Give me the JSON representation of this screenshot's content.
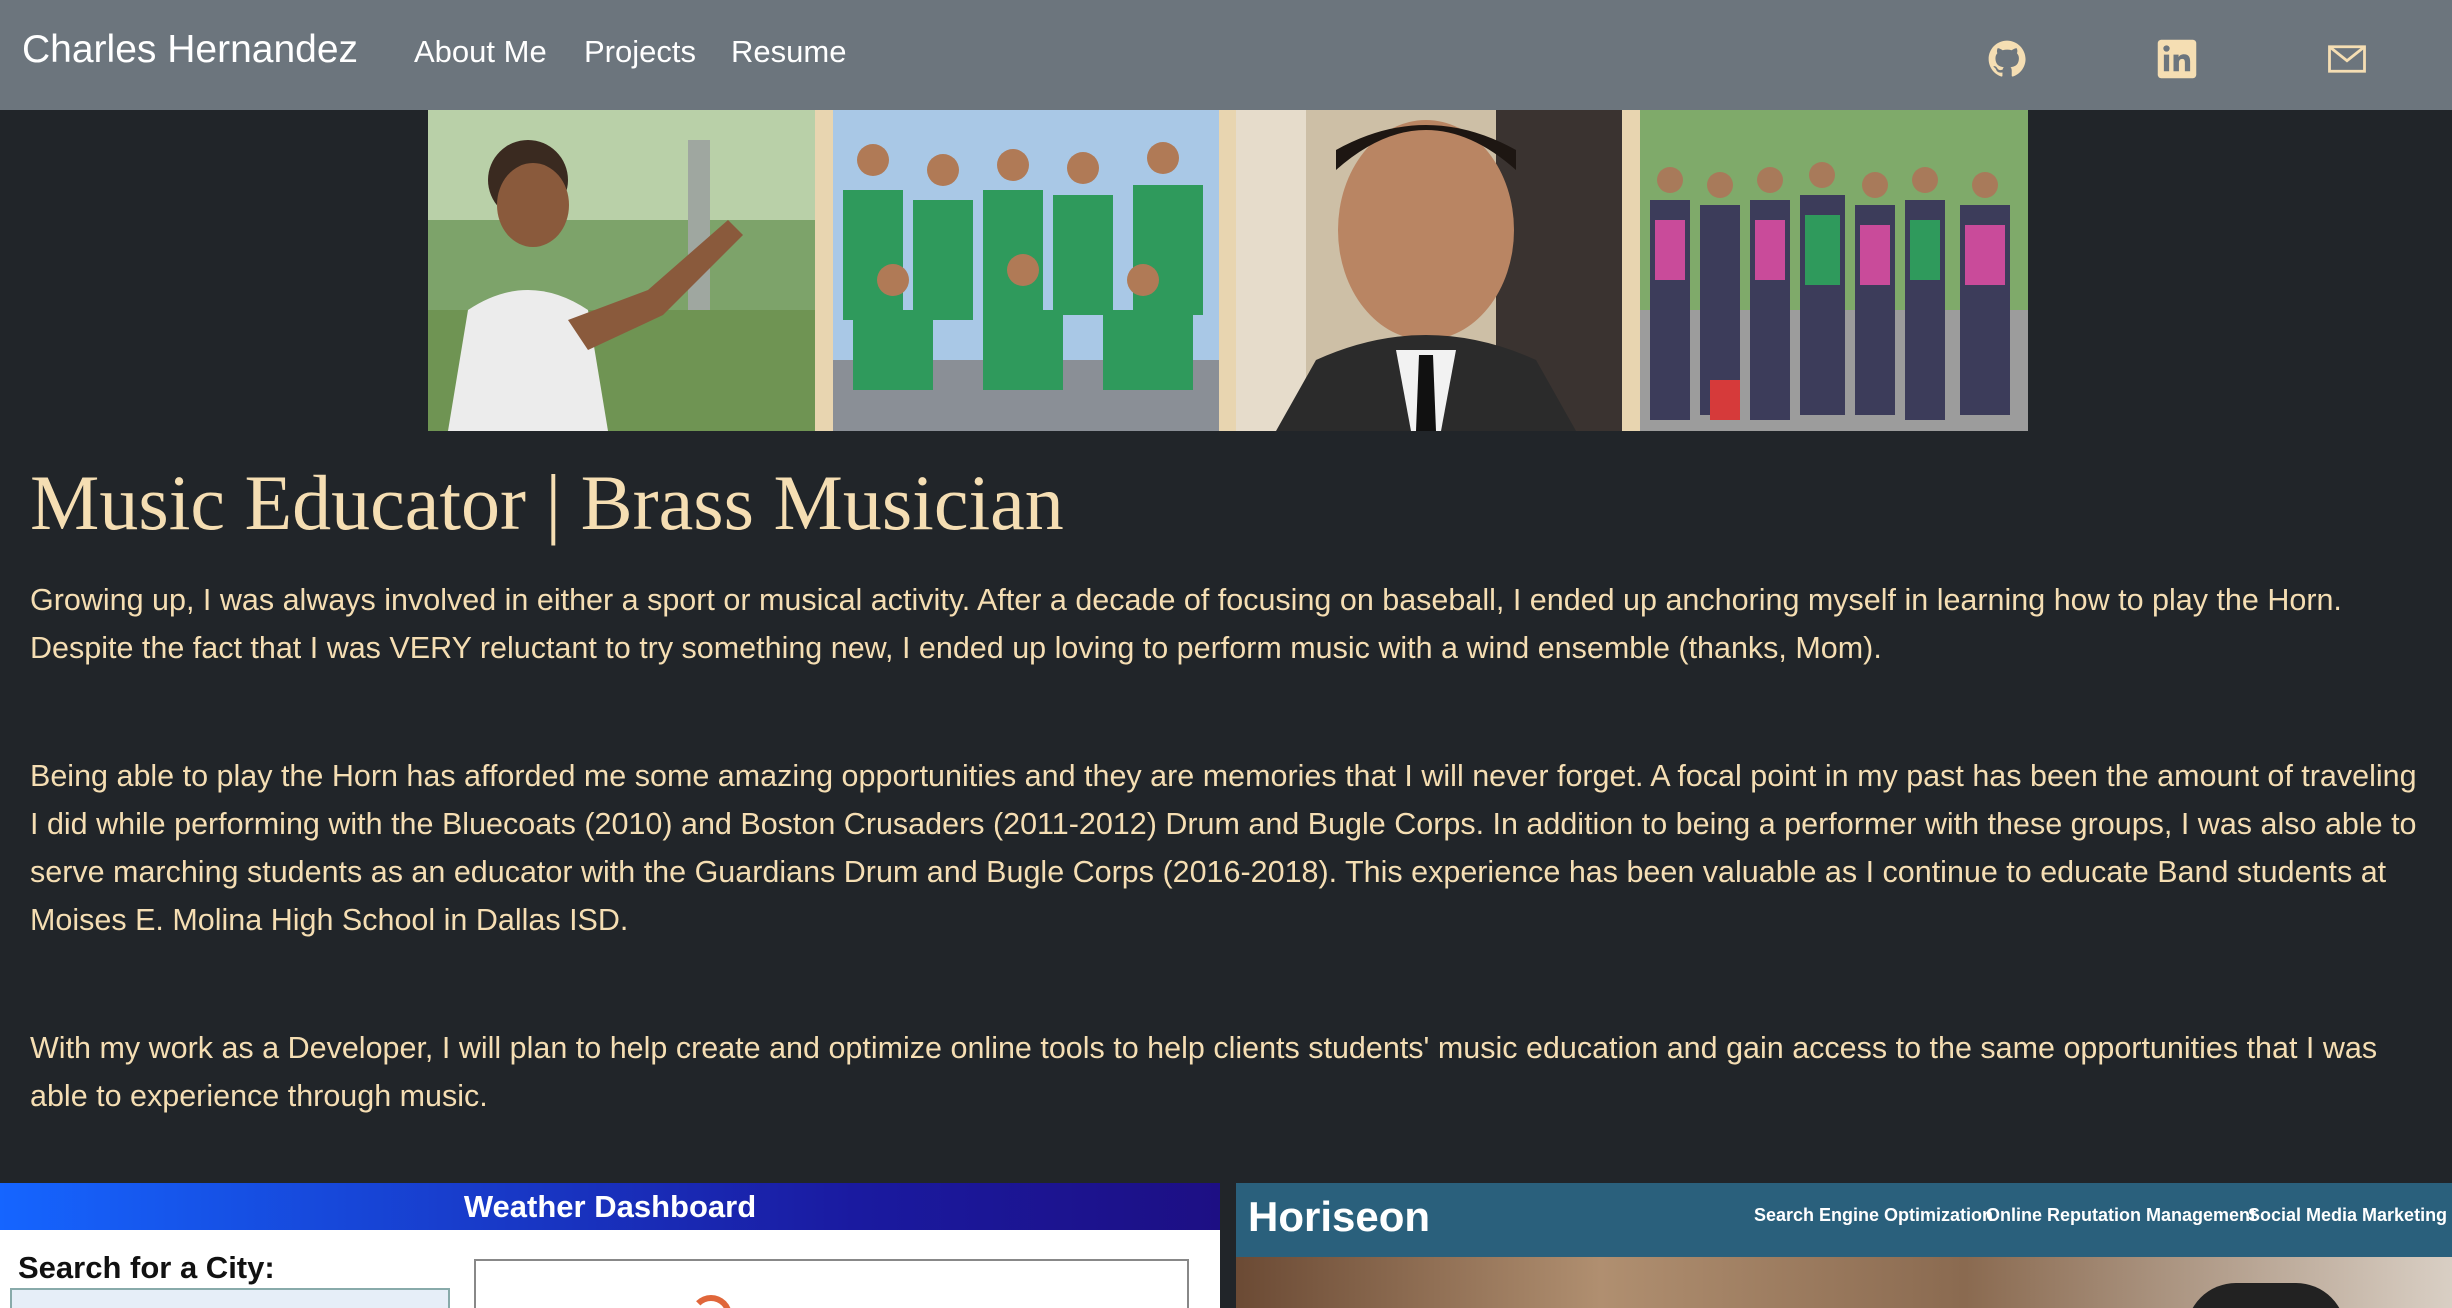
{
  "nav": {
    "brand": "Charles Hernandez",
    "links": [
      "About Me",
      "Projects",
      "Resume"
    ],
    "social_icons": [
      "github-icon",
      "linkedin-icon",
      "mail-icon"
    ]
  },
  "hero": {
    "title": "Music Educator | Brass Musician",
    "paragraphs": [
      "Growing up, I was always involved in either a sport or musical activity. After a decade of focusing on baseball, I ended up anchoring myself in learning how to play the Horn. Despite the fact that I was VERY reluctant to try something new, I ended up loving to perform music with a wind ensemble (thanks, Mom).",
      "Being able to play the Horn has afforded me some amazing opportunities and they are memories that I will never forget. A focal point in my past has been the amount of traveling I did while performing with the Bluecoats (2010) and Boston Crusaders (2011-2012) Drum and Bugle Corps. In addition to being a performer with these groups, I was also able to serve marching students as an educator with the Guardians Drum and Bugle Corps (2016-2018). This experience has been valuable as I continue to educate Band students at Moises E. Molina High School in Dallas ISD.",
      "With my work as a Developer, I will plan to help create and optimize online tools to help clients students' music education and gain access to the same opportunities that I was able to experience through music."
    ]
  },
  "projects": {
    "weather": {
      "header": "Weather Dashboard",
      "search_label": "Search for a City:"
    },
    "horiseon": {
      "logo": "Horiseon",
      "nav": [
        "Search Engine Optimization",
        "Online Reputation Management",
        "Social Media Marketing"
      ]
    }
  },
  "colors": {
    "navbar": "#6c757d",
    "background": "#212529",
    "text_accent": "#f5deb3"
  }
}
